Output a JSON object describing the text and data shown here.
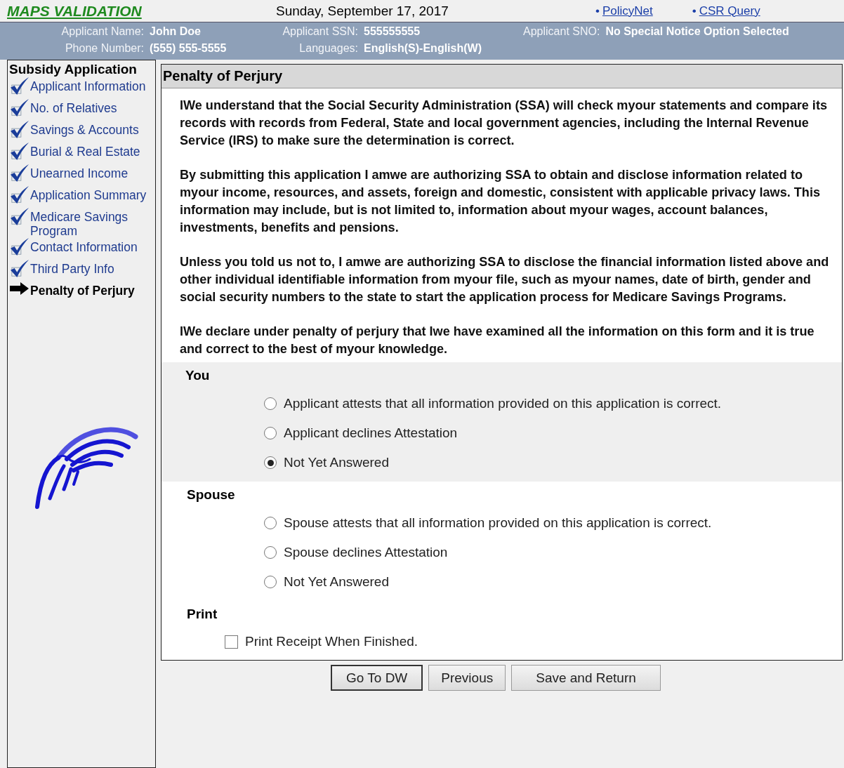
{
  "header": {
    "app_title": "MAPS VALIDATION",
    "date": "Sunday, September 17, 2017",
    "links": [
      {
        "bullet": "•",
        "label": "PolicyNet"
      },
      {
        "bullet": "•",
        "label": "CSR Query"
      }
    ]
  },
  "applicant": {
    "fields": [
      {
        "label": "Applicant Name:",
        "value": "John Doe"
      },
      {
        "label": "Applicant SSN:",
        "value": "555555555"
      },
      {
        "label": "Applicant SNO:",
        "value": "No Special Notice Option Selected"
      },
      {
        "label": "Phone Number:",
        "value": "(555) 555-5555"
      },
      {
        "label": "Languages:",
        "value": "English(S)-English(W)"
      }
    ]
  },
  "sidebar": {
    "title": "Subsidy Application",
    "items": [
      {
        "label": "Applicant Information",
        "selected": false
      },
      {
        "label": "No. of Relatives",
        "selected": false
      },
      {
        "label": "Savings & Accounts",
        "selected": false
      },
      {
        "label": "Burial & Real Estate",
        "selected": false
      },
      {
        "label": "Unearned Income",
        "selected": false
      },
      {
        "label": "Application Summary",
        "selected": false
      },
      {
        "label": "Medicare Savings Program",
        "selected": false
      },
      {
        "label": "Contact Information",
        "selected": false
      },
      {
        "label": "Third Party Info",
        "selected": false
      },
      {
        "label": "Penalty of Perjury",
        "selected": true
      }
    ]
  },
  "panel": {
    "title": "Penalty of Perjury",
    "paragraphs": [
      "IWe understand that the Social Security Administration (SSA) will check myour statements and compare its records with records from Federal, State and local government agencies, including the Internal Revenue Service (IRS) to make sure the determination is correct.",
      "By submitting this application I amwe are authorizing SSA to obtain and disclose information related to myour income, resources, and assets, foreign and domestic, consistent with applicable privacy laws. This information may include, but is not limited to, information about myour wages, account balances, investments, benefits and pensions.",
      "Unless you told us not to, I amwe are authorizing SSA to disclose the financial information listed above and other individual identifiable information from myour file, such as myour names, date of birth, gender and social security numbers to the state to start the application process for Medicare Savings Programs.",
      "IWe declare under penalty of perjury that Iwe have examined all the information on this form and it is true and correct to the best of myour knowledge."
    ],
    "groups": [
      {
        "title": "You",
        "shaded": true,
        "options": [
          {
            "label": "Applicant attests that all information provided on this application is correct.",
            "selected": false
          },
          {
            "label": "Applicant declines Attestation",
            "selected": false
          },
          {
            "label": "Not Yet Answered",
            "selected": true
          }
        ]
      },
      {
        "title": "Spouse",
        "shaded": false,
        "options": [
          {
            "label": "Spouse attests that all information provided on this application is correct.",
            "selected": false
          },
          {
            "label": "Spouse declines Attestation",
            "selected": false
          },
          {
            "label": "Not Yet Answered",
            "selected": false
          }
        ]
      }
    ],
    "print": {
      "title": "Print",
      "label": "Print Receipt When Finished.",
      "checked": false
    }
  },
  "buttons": [
    {
      "label": "Go To DW",
      "default": true
    },
    {
      "label": "Previous",
      "default": false
    },
    {
      "label": "Save and Return",
      "default": false
    }
  ]
}
